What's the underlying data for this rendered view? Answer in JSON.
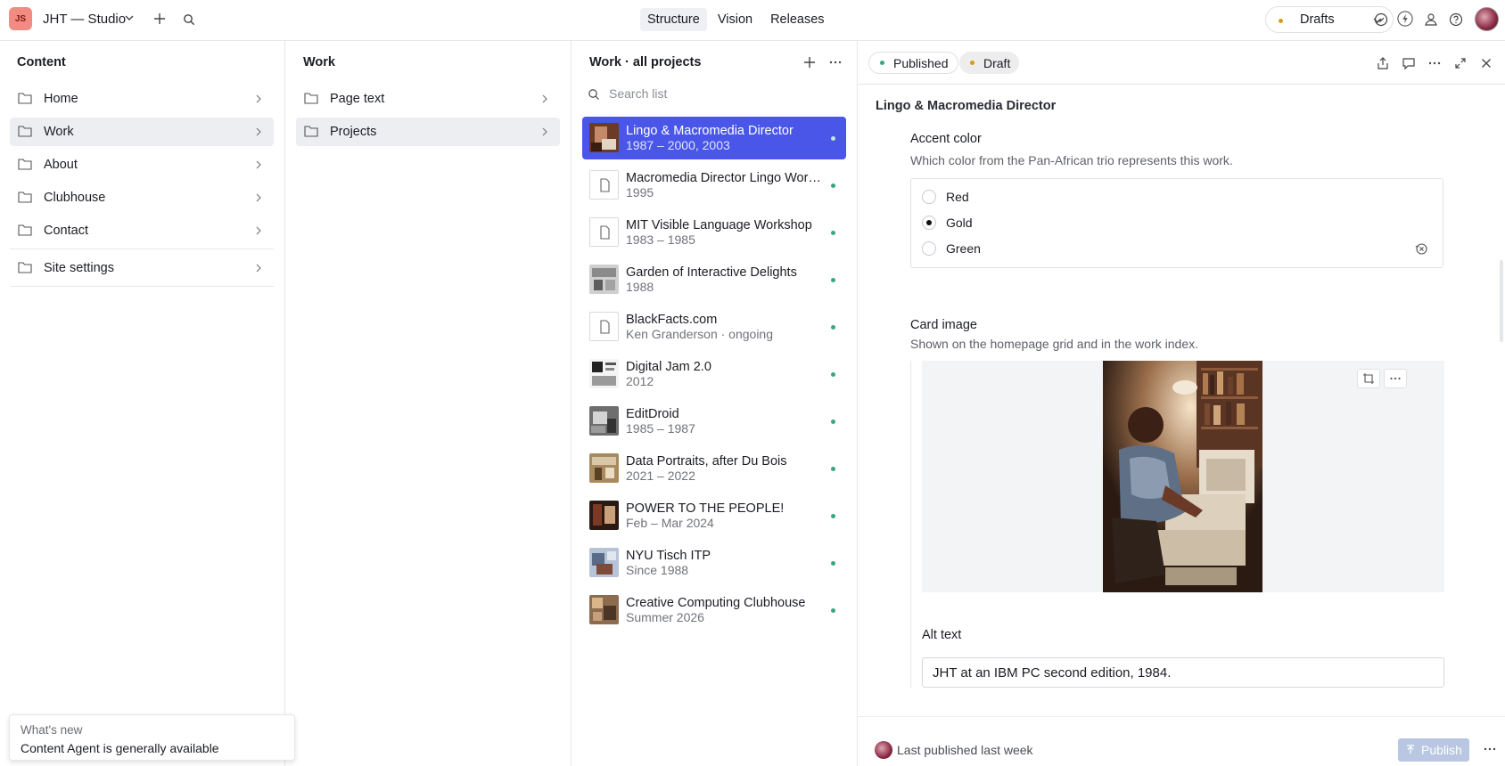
{
  "workspace": {
    "initials": "JS",
    "title": "JHT — Studio"
  },
  "nav": {
    "tabs": [
      "Structure",
      "Vision",
      "Releases"
    ],
    "active": "Structure"
  },
  "perspective": {
    "label": "Drafts",
    "dot_color": "#d49b1f"
  },
  "content_pane": {
    "title": "Content",
    "items": [
      "Home",
      "Work",
      "About",
      "Clubhouse",
      "Contact"
    ],
    "active": "Work",
    "settings": "Site settings"
  },
  "work_pane": {
    "title": "Work",
    "items": [
      "Page text",
      "Projects"
    ],
    "active": "Projects"
  },
  "list_pane": {
    "title": "Work · all projects",
    "search_placeholder": "Search list",
    "items": [
      {
        "title": "Lingo & Macromedia Director",
        "subtitle": "1987 – 2000, 2003"
      },
      {
        "title": "Macromedia Director Lingo Workshop",
        "subtitle": "1995"
      },
      {
        "title": "MIT Visible Language Workshop",
        "subtitle": "1983 – 1985"
      },
      {
        "title": "Garden of Interactive Delights",
        "subtitle": "1988"
      },
      {
        "title": "BlackFacts.com",
        "subtitle": "Ken Granderson · ongoing"
      },
      {
        "title": "Digital Jam 2.0",
        "subtitle": "2012"
      },
      {
        "title": "EditDroid",
        "subtitle": "1985 – 1987"
      },
      {
        "title": "Data Portraits, after Du Bois",
        "subtitle": "2021 – 2022"
      },
      {
        "title": "POWER TO THE PEOPLE!",
        "subtitle": "Feb – Mar 2024"
      },
      {
        "title": "NYU Tisch ITP",
        "subtitle": "Since 1988"
      },
      {
        "title": "Creative Computing Clubhouse",
        "subtitle": "Summer 2026"
      }
    ]
  },
  "document": {
    "status_published": "Published",
    "status_draft": "Draft",
    "title": "Lingo & Macromedia Director",
    "accent": {
      "label": "Accent color",
      "description": "Which color from the Pan-African trio represents this work.",
      "options": [
        "Red",
        "Gold",
        "Green"
      ],
      "selected": "Gold"
    },
    "card_image": {
      "label": "Card image",
      "description": "Shown on the homepage grid and in the work index."
    },
    "alt_text": {
      "label": "Alt text",
      "value": "JHT at an IBM PC second edition, 1984."
    },
    "footer": {
      "last_published": "Last published last week",
      "publish_label": "Publish"
    }
  },
  "toast": {
    "heading": "What's new",
    "body": "Content Agent is generally available"
  },
  "colors": {
    "accent_selected": "#4a56e8",
    "published_dot": "#3aa67a",
    "draft_dot": "#d49b1f"
  }
}
